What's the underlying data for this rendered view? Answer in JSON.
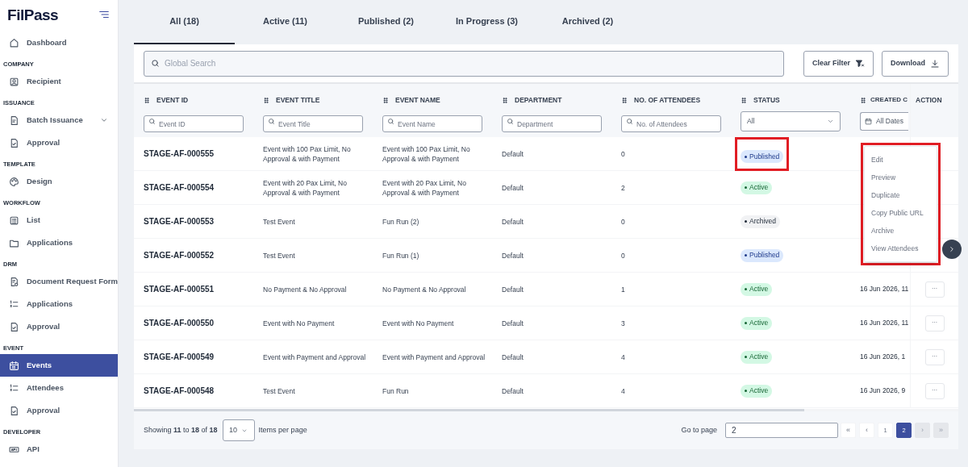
{
  "sidebar": {
    "logo": "FilPass",
    "sections": [
      {
        "items": [
          {
            "label": "Dashboard",
            "selected": false,
            "expandable": false
          }
        ]
      },
      {
        "heading": "COMPANY",
        "items": [
          {
            "label": "Recipient",
            "selected": false,
            "expandable": false
          }
        ]
      },
      {
        "heading": "ISSUANCE",
        "items": [
          {
            "label": "Batch Issuance",
            "selected": false,
            "expandable": true
          },
          {
            "label": "Approval",
            "selected": false,
            "expandable": false
          }
        ]
      },
      {
        "heading": "TEMPLATE",
        "items": [
          {
            "label": "Design",
            "selected": false,
            "expandable": false
          }
        ]
      },
      {
        "heading": "WORKFLOW",
        "items": [
          {
            "label": "List",
            "selected": false,
            "expandable": false
          },
          {
            "label": "Applications",
            "selected": false,
            "expandable": false
          }
        ]
      },
      {
        "heading": "DRM",
        "items": [
          {
            "label": "Document Request Form",
            "selected": false,
            "expandable": false
          },
          {
            "label": "Applications",
            "selected": false,
            "expandable": false
          },
          {
            "label": "Approval",
            "selected": false,
            "expandable": false
          }
        ]
      },
      {
        "heading": "EVENT",
        "items": [
          {
            "label": "Events",
            "selected": true,
            "expandable": false
          },
          {
            "label": "Attendees",
            "selected": false,
            "expandable": false
          },
          {
            "label": "Approval",
            "selected": false,
            "expandable": false
          }
        ]
      },
      {
        "heading": "DEVELOPER",
        "items": [
          {
            "label": "API",
            "selected": false,
            "expandable": false
          }
        ]
      }
    ]
  },
  "tabs": [
    {
      "label": "All (18)",
      "selected": true
    },
    {
      "label": "Active (11)",
      "selected": false
    },
    {
      "label": "Published (2)",
      "selected": false
    },
    {
      "label": "In Progress (3)",
      "selected": false
    },
    {
      "label": "Archived (2)",
      "selected": false
    }
  ],
  "search": {
    "placeholder": "Global Search"
  },
  "buttons": [
    {
      "label": "Clear Filter",
      "kind": "clear"
    },
    {
      "label": "Download",
      "kind": "download"
    }
  ],
  "table": {
    "columns": [
      {
        "label": "EVENT ID",
        "filter": {
          "kind": "text",
          "placeholder": "Event ID"
        }
      },
      {
        "label": "EVENT TITLE",
        "filter": {
          "kind": "text",
          "placeholder": "Event Title"
        }
      },
      {
        "label": "EVENT NAME",
        "filter": {
          "kind": "text",
          "placeholder": "Event Name"
        }
      },
      {
        "label": "DEPARTMENT",
        "filter": {
          "kind": "text",
          "placeholder": "Department"
        }
      },
      {
        "label": "NO. OF ATTENDEES",
        "filter": {
          "kind": "text",
          "placeholder": "No. of Attendees"
        }
      },
      {
        "label": "STATUS",
        "filter": {
          "kind": "select",
          "value": "All"
        }
      },
      {
        "label": "CREATED C",
        "filter": {
          "kind": "date",
          "value": "All Dates"
        }
      },
      {
        "label": "ACTION"
      }
    ],
    "rows": [
      {
        "event_id": "STAGE-AF-000555",
        "event_title": "Event with 100 Pax Limit, No Approval & with Payment",
        "event_name": "Event with 100 Pax Limit, No Approval & with Payment",
        "department": "Default",
        "attendees": "0",
        "status": {
          "label": "Published",
          "kind": "published"
        },
        "highlighted": true
      },
      {
        "event_id": "STAGE-AF-000554",
        "event_title": "Event with 20 Pax Limit, No Approval & with Payment",
        "event_name": "Event with 20 Pax Limit, No Approval & with Payment",
        "department": "Default",
        "attendees": "2",
        "status": {
          "label": "Active",
          "kind": "active"
        },
        "highlighted": false
      },
      {
        "event_id": "STAGE-AF-000553",
        "event_title": "Test Event",
        "event_name": "Fun Run (2)",
        "department": "Default",
        "attendees": "0",
        "status": {
          "label": "Archived",
          "kind": "archived"
        },
        "highlighted": false
      },
      {
        "event_id": "STAGE-AF-000552",
        "event_title": "Test Event",
        "event_name": "Fun Run (1)",
        "department": "Default",
        "attendees": "0",
        "status": {
          "label": "Published",
          "kind": "published"
        },
        "highlighted": false
      },
      {
        "event_id": "STAGE-AF-000551",
        "event_title": "No Payment & No Approval",
        "event_name": "No Payment & No Approval",
        "department": "Default",
        "attendees": "1",
        "status": {
          "label": "Active",
          "kind": "active"
        },
        "highlighted": false,
        "created_on": "16 Jun 2026, 11",
        "action": "···"
      },
      {
        "event_id": "STAGE-AF-000550",
        "event_title": "Event with No Payment",
        "event_name": "Event with No Payment",
        "department": "Default",
        "attendees": "3",
        "status": {
          "label": "Active",
          "kind": "active"
        },
        "highlighted": false,
        "created_on": "16 Jun 2026, 11",
        "action": "···"
      },
      {
        "event_id": "STAGE-AF-000549",
        "event_title": "Event with Payment and Approval",
        "event_name": "Event with Payment and Approval",
        "department": "Default",
        "attendees": "4",
        "status": {
          "label": "Active",
          "kind": "active"
        },
        "highlighted": false,
        "created_on": "16 Jun 2026, 1",
        "action": "···"
      },
      {
        "event_id": "STAGE-AF-000548",
        "event_title": "Test Event",
        "event_name": "Fun Run",
        "department": "Default",
        "attendees": "4",
        "status": {
          "label": "Active",
          "kind": "active"
        },
        "highlighted": false,
        "created_on": "16 Jun 2026, 9",
        "action": "···"
      }
    ]
  },
  "action_menu": {
    "highlighted": true,
    "items": [
      "Edit",
      "Preview",
      "Duplicate",
      "Copy Public URL",
      "Archive",
      "View Attendees"
    ]
  },
  "footer": {
    "summary": "Showing **11** to **18** of **18**",
    "per_page": "10",
    "per_page_label": "Items per page",
    "go_to_label": "Go to page",
    "go_to_value": "2",
    "pages": [
      {
        "label": "«",
        "kind": "nav",
        "disabled": false,
        "selected": false
      },
      {
        "label": "‹",
        "kind": "nav",
        "disabled": false,
        "selected": false
      },
      {
        "label": "1",
        "kind": "page",
        "disabled": false,
        "selected": false
      },
      {
        "label": "2",
        "kind": "page",
        "disabled": false,
        "selected": true
      },
      {
        "label": "›",
        "kind": "nav",
        "disabled": true,
        "selected": false
      },
      {
        "label": "»",
        "kind": "nav",
        "disabled": true,
        "selected": false
      }
    ]
  }
}
